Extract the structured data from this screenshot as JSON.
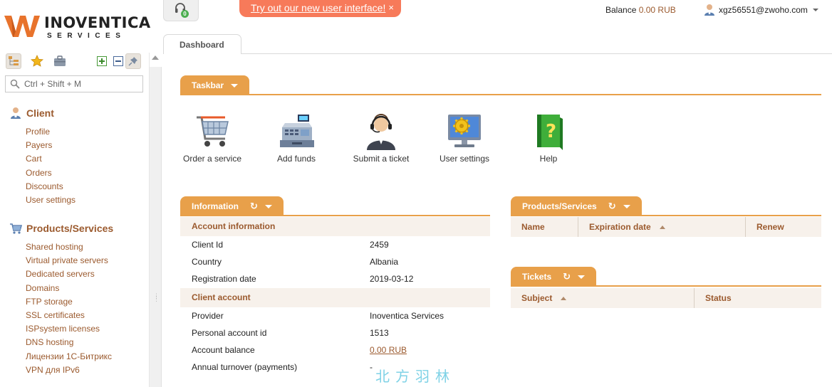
{
  "logo": {
    "word": "INOVENTICA",
    "sub": "SERVICES"
  },
  "search": {
    "placeholder": "Ctrl + Shift + M"
  },
  "sidebar": {
    "groups": [
      {
        "title": "Client",
        "icon": "user-icon",
        "items": [
          "Profile",
          "Payers",
          "Cart",
          "Orders",
          "Discounts",
          "User settings"
        ]
      },
      {
        "title": "Products/Services",
        "icon": "cart-icon",
        "items": [
          "Shared hosting",
          "Virtual private servers",
          "Dedicated servers",
          "Domains",
          "FTP storage",
          "SSL certificates",
          "ISPsystem licenses",
          "DNS hosting",
          "Лицензии 1С-Битрикс",
          "VPN для IPv6"
        ]
      }
    ]
  },
  "topbar": {
    "notifications_count": "0",
    "promo_text": "Try out our new user interface!",
    "promo_close": "×",
    "balance_label": "Balance",
    "balance_value": "0.00 RUB",
    "user_email": "xgz56551@zwoho.com"
  },
  "tabs": [
    {
      "label": "Dashboard"
    }
  ],
  "taskbar": {
    "title": "Taskbar",
    "items": [
      {
        "label": "Order a service",
        "icon": "shopping-cart-icon"
      },
      {
        "label": "Add funds",
        "icon": "cash-register-icon"
      },
      {
        "label": "Submit a ticket",
        "icon": "support-agent-icon"
      },
      {
        "label": "User settings",
        "icon": "monitor-gear-icon"
      },
      {
        "label": "Help",
        "icon": "help-book-icon"
      }
    ]
  },
  "information": {
    "title": "Information",
    "account_section": "Account information",
    "account_rows": [
      {
        "key": "Client Id",
        "value": "2459"
      },
      {
        "key": "Country",
        "value": "Albania"
      },
      {
        "key": "Registration date",
        "value": "2019-03-12"
      }
    ],
    "client_section": "Client account",
    "client_rows": [
      {
        "key": "Provider",
        "value": "Inoventica Services"
      },
      {
        "key": "Personal account id",
        "value": "1513"
      },
      {
        "key": "Account balance",
        "value": "0.00 RUB"
      },
      {
        "key": "Annual turnover (payments)",
        "value": "-"
      }
    ]
  },
  "products": {
    "title": "Products/Services",
    "columns": [
      "Name",
      "Expiration date",
      "Renew"
    ]
  },
  "tickets": {
    "title": "Tickets",
    "columns": [
      "Subject",
      "Status"
    ]
  },
  "watermark": "北方羽林",
  "colors": {
    "accent": "#e8a04a",
    "link": "#9b5a2e",
    "promo": "#f77a5a"
  }
}
